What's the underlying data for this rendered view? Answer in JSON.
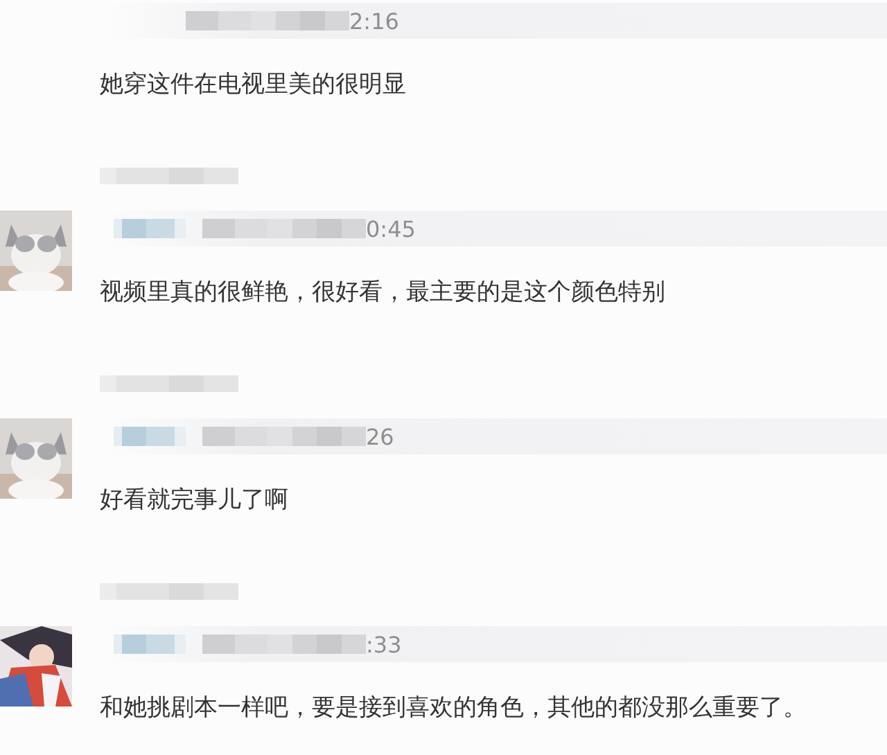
{
  "comments": [
    {
      "redacted_name": false,
      "time": "2:16",
      "text": "她穿这件在电视里美的很明显"
    },
    {
      "redacted_name": true,
      "time": "0:45",
      "text": "视频里真的很鲜艳，很好看，最主要的是这个颜色特别"
    },
    {
      "redacted_name": true,
      "time": "26",
      "text": "好看就完事儿了啊"
    },
    {
      "redacted_name": true,
      "time": ":33",
      "text": "和她挑剧本一样吧，要是接到喜欢的角色，其他的都没那么重要了。"
    }
  ]
}
